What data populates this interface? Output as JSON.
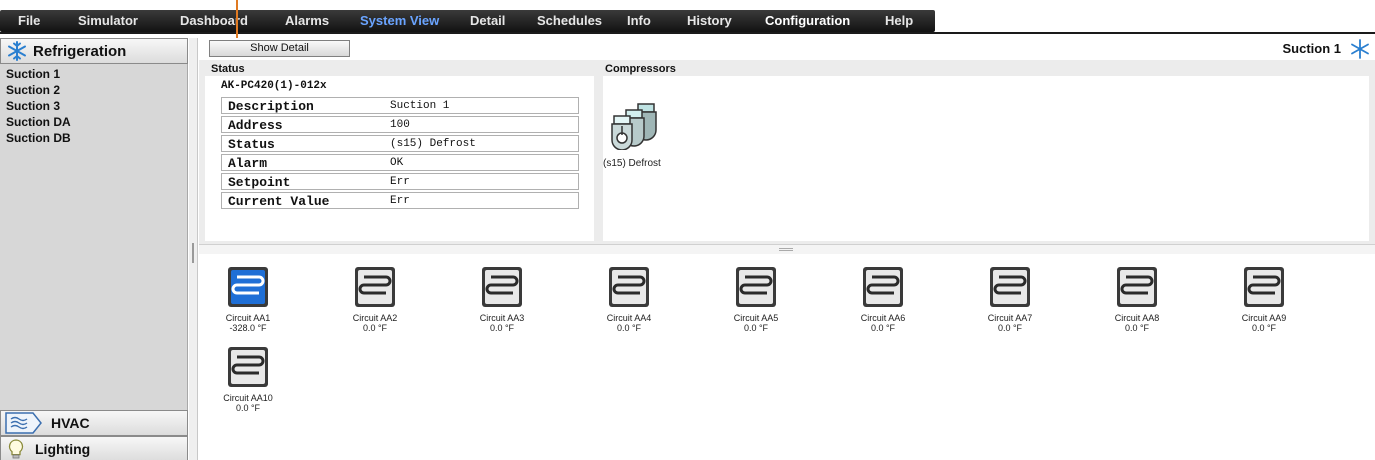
{
  "menu": [
    {
      "label": "File"
    },
    {
      "label": "Simulator"
    },
    {
      "label": "Dashboard"
    },
    {
      "label": "Alarms"
    },
    {
      "label": "System View",
      "active": true
    },
    {
      "label": "Detail"
    },
    {
      "label": "Schedules"
    },
    {
      "label": "Info"
    },
    {
      "label": "History"
    },
    {
      "label": "Configuration"
    },
    {
      "label": "Help"
    }
  ],
  "sidebar": {
    "header": "Refrigeration",
    "items": [
      "Suction 1",
      "Suction 2",
      "Suction 3",
      "Suction DA",
      "Suction DB"
    ],
    "bottom": [
      {
        "label": "HVAC",
        "icon": "hvac-icon"
      },
      {
        "label": "Lighting",
        "icon": "lightbulb-icon"
      }
    ]
  },
  "toolbar": {
    "show_detail": "Show Detail",
    "title": "Suction 1"
  },
  "status": {
    "section_label": "Status",
    "device": "AK-PC420(1)-012x",
    "rows": [
      {
        "key": "Description",
        "value": "Suction 1"
      },
      {
        "key": "Address",
        "value": "100"
      },
      {
        "key": "Status",
        "value": "(s15) Defrost"
      },
      {
        "key": "Alarm",
        "value": "OK"
      },
      {
        "key": "Setpoint",
        "value": "Err"
      },
      {
        "key": "Current Value",
        "value": "Err"
      }
    ]
  },
  "compressors": {
    "section_label": "Compressors",
    "state": "(s15) Defrost"
  },
  "circuits": [
    {
      "name": "Circuit AA1",
      "value": "-328.0 °F",
      "active": true
    },
    {
      "name": "Circuit AA2",
      "value": "0.0 °F"
    },
    {
      "name": "Circuit AA3",
      "value": "0.0 °F"
    },
    {
      "name": "Circuit AA4",
      "value": "0.0 °F"
    },
    {
      "name": "Circuit AA5",
      "value": "0.0 °F"
    },
    {
      "name": "Circuit AA6",
      "value": "0.0 °F"
    },
    {
      "name": "Circuit AA7",
      "value": "0.0 °F"
    },
    {
      "name": "Circuit AA8",
      "value": "0.0 °F"
    },
    {
      "name": "Circuit AA9",
      "value": "0.0 °F"
    },
    {
      "name": "Circuit AA10",
      "value": "0.0 °F"
    }
  ],
  "colors": {
    "active_circuit": "#1f6fd6",
    "menu_active": "#6aa4ff"
  }
}
